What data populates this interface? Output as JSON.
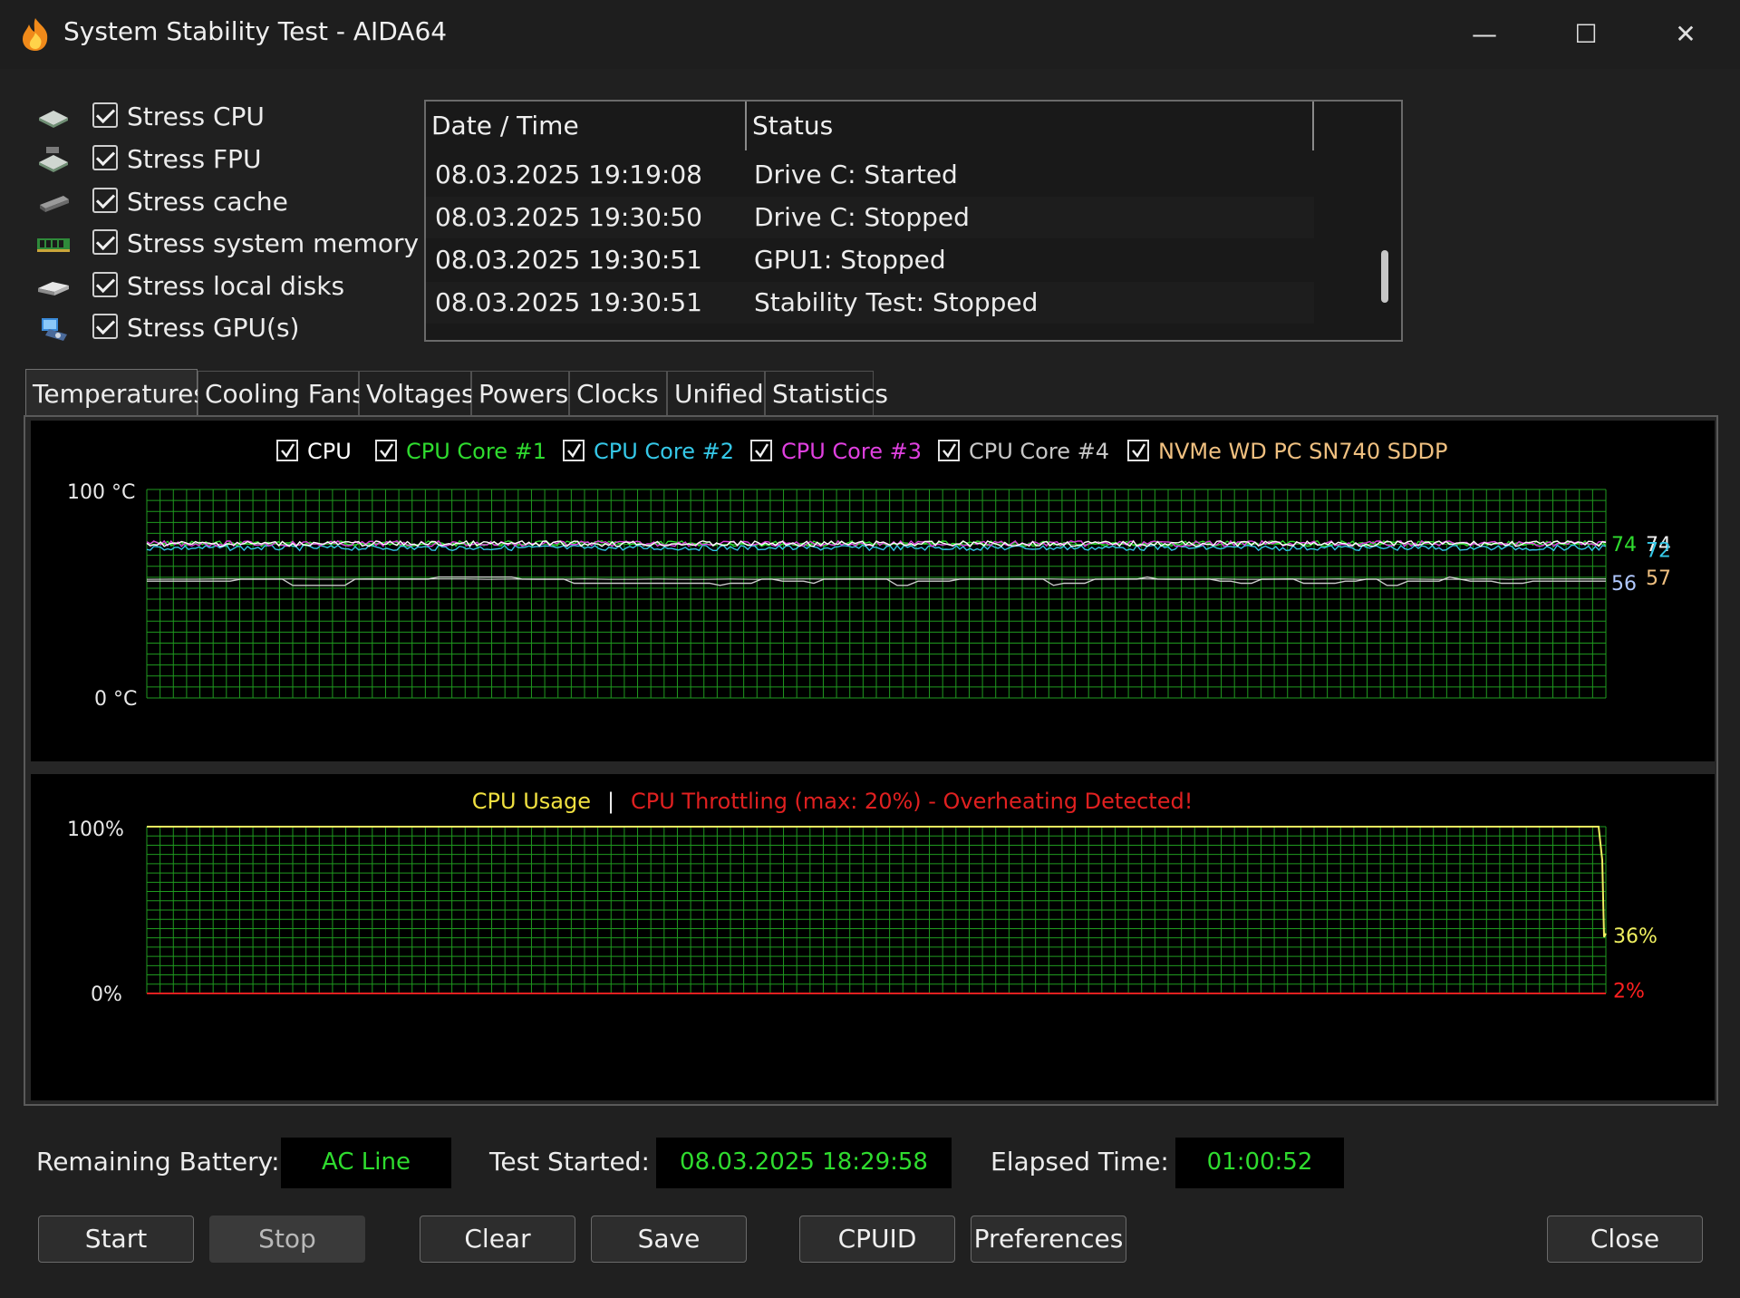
{
  "window": {
    "title": "System Stability Test - AIDA64",
    "controls": {
      "minimize": "—",
      "maximize": "☐",
      "close": "✕"
    }
  },
  "stress_options": [
    {
      "label": "Stress CPU",
      "icon": "cpu-chip-icon",
      "checked": true
    },
    {
      "label": "Stress FPU",
      "icon": "fpu-chip-icon",
      "checked": true
    },
    {
      "label": "Stress cache",
      "icon": "cache-chip-icon",
      "checked": true
    },
    {
      "label": "Stress system memory",
      "icon": "memory-module-icon",
      "checked": true
    },
    {
      "label": "Stress local disks",
      "icon": "disk-drive-icon",
      "checked": true
    },
    {
      "label": "Stress GPU(s)",
      "icon": "gpu-card-icon",
      "checked": true
    }
  ],
  "log": {
    "columns": [
      "Date / Time",
      "Status"
    ],
    "rows": [
      [
        "08.03.2025 19:19:08",
        "Drive C: Started"
      ],
      [
        "08.03.2025 19:30:50",
        "Drive C: Stopped"
      ],
      [
        "08.03.2025 19:30:51",
        "GPU1: Stopped"
      ],
      [
        "08.03.2025 19:30:51",
        "Stability Test: Stopped"
      ]
    ]
  },
  "tabs": [
    {
      "label": "Temperatures",
      "active": true
    },
    {
      "label": "Cooling Fans",
      "active": false
    },
    {
      "label": "Voltages",
      "active": false
    },
    {
      "label": "Powers",
      "active": false
    },
    {
      "label": "Clocks",
      "active": false
    },
    {
      "label": "Unified",
      "active": false
    },
    {
      "label": "Statistics",
      "active": false
    }
  ],
  "chart_data": [
    {
      "type": "line",
      "ylim": [
        0,
        100
      ],
      "y_top_label": "100",
      "y_bottom_label": "0",
      "y_unit": "°C",
      "grid": true,
      "grid_color": "#1f9a1f",
      "series": [
        {
          "name": "CPU",
          "color": "#ffffff",
          "checked": true,
          "current": 74
        },
        {
          "name": "CPU Core #1",
          "color": "#2fdc2f",
          "checked": true,
          "current": 74
        },
        {
          "name": "CPU Core #2",
          "color": "#35c8e8",
          "checked": true,
          "current": 72
        },
        {
          "name": "CPU Core #3",
          "color": "#e040e0",
          "checked": true,
          "current": 74
        },
        {
          "name": "CPU Core #4",
          "color": "#c8c8c8",
          "checked": true,
          "current": 56
        },
        {
          "name": "NVMe WD PC SN740 SDDP",
          "color": "#f0c080",
          "checked": true,
          "current": 57
        }
      ],
      "value_labels": [
        {
          "text": "74",
          "color": "#2fdc2f"
        },
        {
          "text": "74",
          "color": "#f0f0f0"
        },
        {
          "text": "72",
          "color": "#35c8e8"
        },
        {
          "text": "56",
          "color": "#b0c8ff"
        },
        {
          "text": "57",
          "color": "#f0c080"
        }
      ]
    },
    {
      "type": "line",
      "ylim": [
        0,
        100
      ],
      "y_top_label": "100%",
      "y_bottom_label": "0%",
      "grid": true,
      "grid_color": "#1f9a1f",
      "title_left": "CPU Usage",
      "title_sep": "|",
      "title_right": "CPU Throttling (max: 20%) - Overheating Detected!",
      "series": [
        {
          "name": "CPU Usage",
          "color": "#f0f060",
          "current": 36
        },
        {
          "name": "CPU Throttling",
          "color": "#e02020",
          "current": 2
        }
      ],
      "value_labels": [
        {
          "text": "36%",
          "color": "#f0f060"
        },
        {
          "text": "2%",
          "color": "#ff2020"
        }
      ]
    }
  ],
  "status": {
    "battery_label": "Remaining Battery:",
    "battery_value": "AC Line",
    "started_label": "Test Started:",
    "started_value": "08.03.2025 18:29:58",
    "elapsed_label": "Elapsed Time:",
    "elapsed_value": "01:00:52"
  },
  "buttons": {
    "start": "Start",
    "stop": "Stop",
    "clear": "Clear",
    "save": "Save",
    "cpuid": "CPUID",
    "preferences": "Preferences",
    "close": "Close"
  }
}
